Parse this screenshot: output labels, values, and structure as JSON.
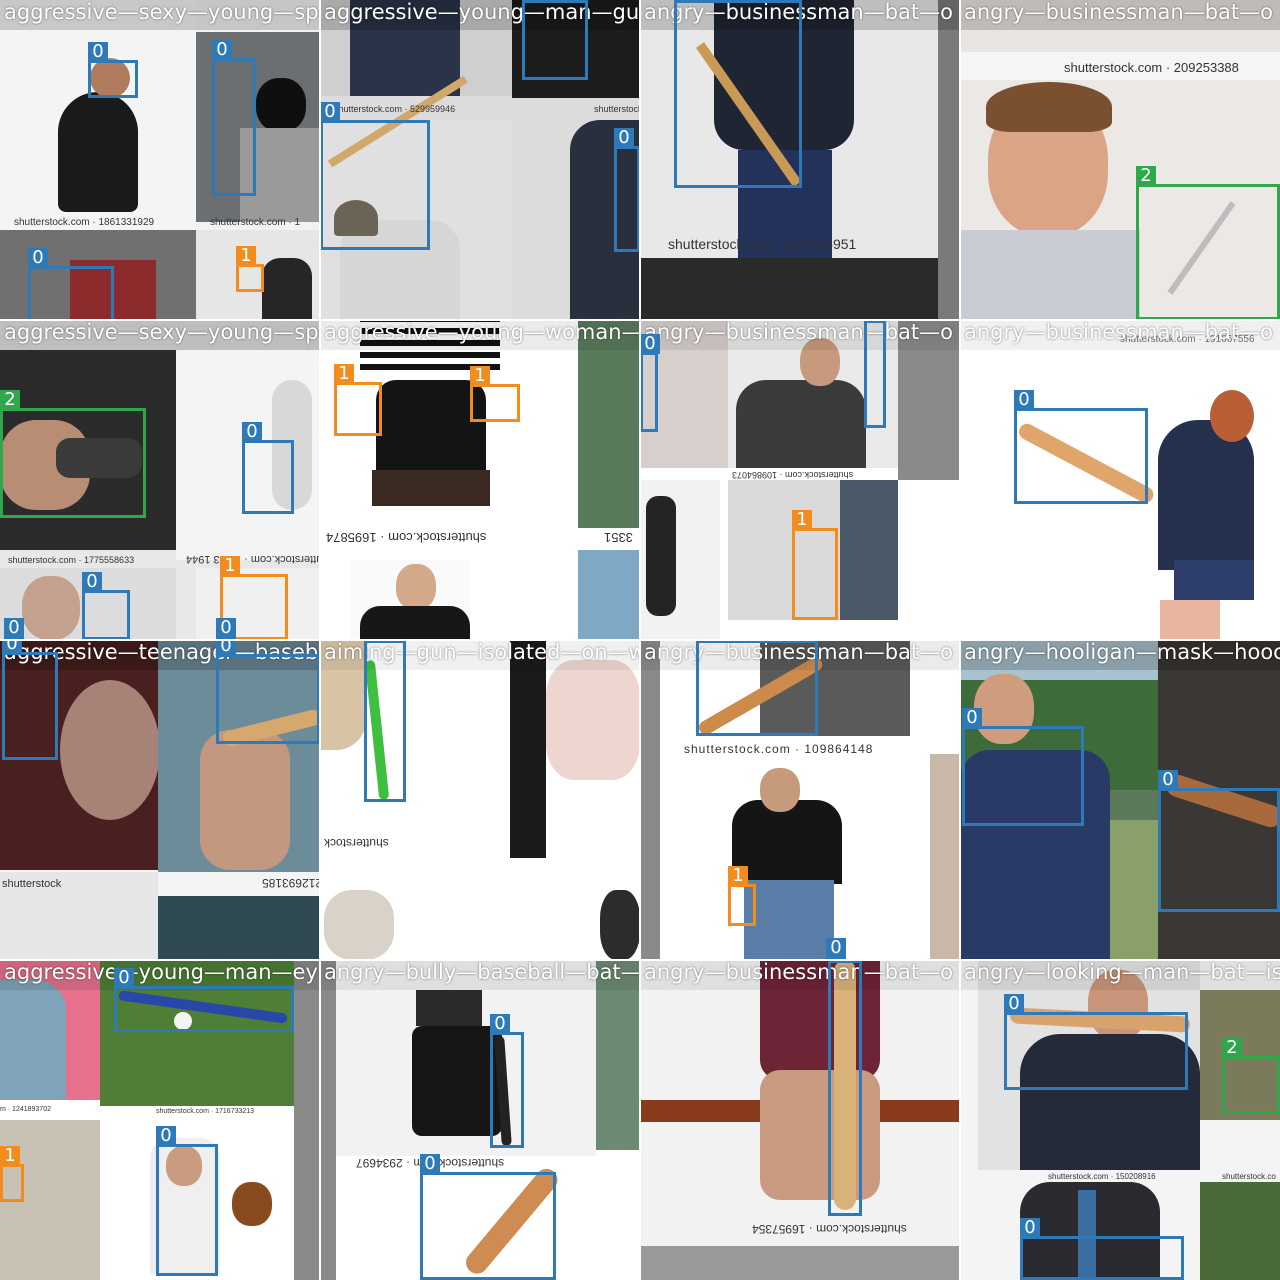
{
  "class_colors": {
    "0": "#2e7ab8",
    "1": "#f28c1e",
    "2": "#2ea84a"
  },
  "tiles": [
    {
      "title": "aggressive—sexy—young—sp",
      "watermarks": [
        "shutterstock.com · 1861331929",
        "shutterstock.com · 1"
      ],
      "detections": [
        {
          "label": "0"
        },
        {
          "label": "0"
        },
        {
          "label": "0"
        },
        {
          "label": "1"
        }
      ]
    },
    {
      "title": "aggressive—young—man—gu",
      "watermarks": [
        "shutterstock.com · 529959946",
        "shutterstock.co"
      ],
      "detections": [
        {
          "label": "0"
        },
        {
          "label": "0"
        },
        {
          "label": "0"
        }
      ]
    },
    {
      "title": "angry—businessman—bat—o",
      "watermarks": [
        "shutterstock.com · 270545951"
      ],
      "detections": [
        {
          "label": "0"
        }
      ]
    },
    {
      "title": "angry—businessman—bat—o",
      "watermarks": [
        "shutterstock.com · 209253388"
      ],
      "detections": [
        {
          "label": "2"
        }
      ]
    },
    {
      "title": "aggressive—sexy—young—sp",
      "watermarks": [
        "shutterstock.com · 1775558633",
        "shutterstock.com · 186 3 1944"
      ],
      "detections": [
        {
          "label": "2"
        },
        {
          "label": "0"
        },
        {
          "label": "0"
        },
        {
          "label": "1"
        },
        {
          "label": "0"
        },
        {
          "label": "0"
        }
      ]
    },
    {
      "title": "aggressive—young—woman—",
      "watermarks": [
        "shutterstock.com · 1695874",
        "3351"
      ],
      "detections": [
        {
          "label": "1"
        },
        {
          "label": "1"
        }
      ]
    },
    {
      "title": "angry—businessman—bat—o",
      "watermarks": [
        "shutterstock.com · 109864073"
      ],
      "detections": [
        {
          "label": "0"
        },
        {
          "label": "0"
        },
        {
          "label": "1"
        }
      ]
    },
    {
      "title": "angry—businessman—bat—o",
      "watermarks": [
        "shutterstock.com · 191667556"
      ],
      "detections": [
        {
          "label": "0"
        }
      ]
    },
    {
      "title": "aggressive—teenager—baseb",
      "watermarks": [
        "shutterstock",
        "212693185"
      ],
      "detections": [
        {
          "label": "0"
        },
        {
          "label": "0"
        }
      ]
    },
    {
      "title": "aiming—gun—isolated—on—w",
      "watermarks": [
        "shutterstock"
      ],
      "detections": [
        {
          "label": "0"
        }
      ]
    },
    {
      "title": "angry—businessman—bat—o",
      "watermarks": [
        "shutterstock.com · 109864148"
      ],
      "detections": [
        {
          "label": "0"
        },
        {
          "label": "1"
        },
        {
          "label": "0"
        }
      ]
    },
    {
      "title": "angry—hooligan—mask—hooc",
      "watermarks": [],
      "detections": [
        {
          "label": "0"
        },
        {
          "label": "0"
        }
      ]
    },
    {
      "title": "aggressive—young—man—ey",
      "watermarks": [
        "shutterstock.com · 1716733213",
        "m · 1241893702"
      ],
      "detections": [
        {
          "label": "0"
        },
        {
          "label": "0"
        },
        {
          "label": "1"
        }
      ]
    },
    {
      "title": "angry—bully—baseball—bat—",
      "watermarks": [
        "shutterstock.com · 2934697"
      ],
      "detections": [
        {
          "label": "0"
        },
        {
          "label": "0"
        }
      ]
    },
    {
      "title": "angry—businessman—bat—o",
      "watermarks": [
        "shutterstock.com · 16957354"
      ],
      "detections": [
        {
          "label": "0"
        }
      ]
    },
    {
      "title": "angry—looking—man—bat—is",
      "watermarks": [
        "shutterstock.com · 150208916",
        "shutterstock.co"
      ],
      "detections": [
        {
          "label": "0"
        },
        {
          "label": "2"
        },
        {
          "label": "0"
        }
      ]
    }
  ]
}
